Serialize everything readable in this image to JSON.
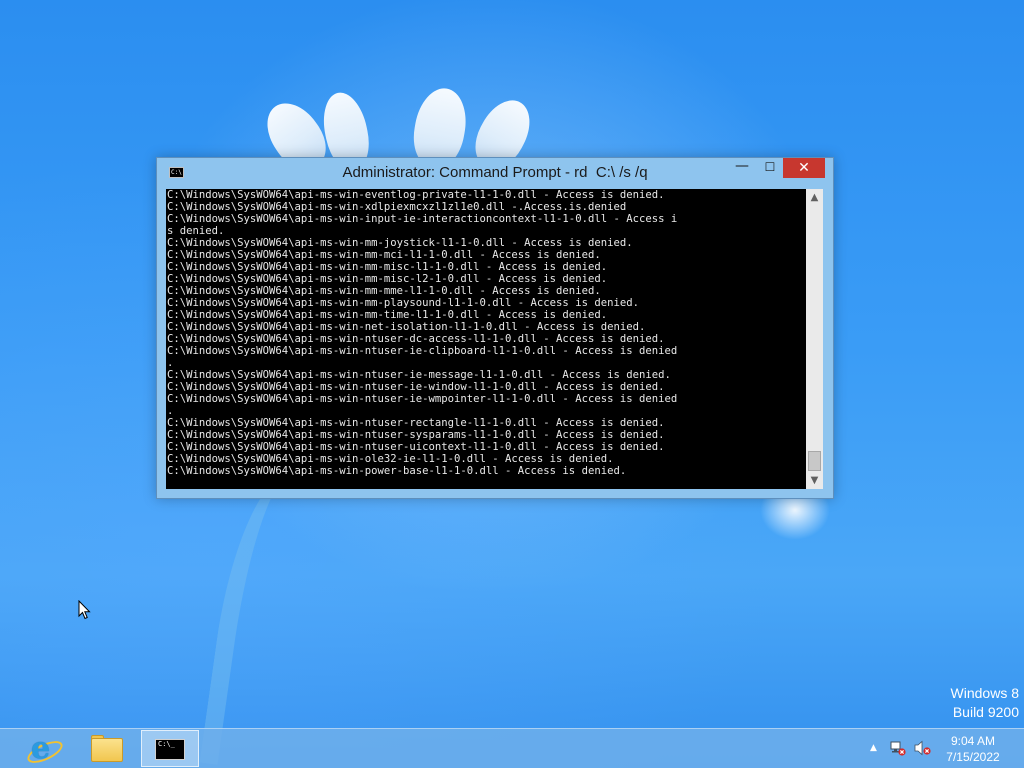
{
  "window": {
    "title": "Administrator: Command Prompt - rd  C:\\ /s /q",
    "icon_glyph": "C:\\",
    "minimize_glyph": "—",
    "maximize_glyph": "☐",
    "close_glyph": "✕"
  },
  "console": {
    "text_color": "#e8e8e8",
    "background": "#000000",
    "lines": [
      "C:\\Windows\\SysWOW64\\api-ms-win-eventlog-private-l1-1-0.dll - Access is denied.",
      "C:\\Windows\\SysWOW64\\api-ms-win-xdlpiexmcxzl1zl1e0.dll -.Access.is.denied",
      "C:\\Windows\\SysWOW64\\api-ms-win-input-ie-interactioncontext-l1-1-0.dll - Access i",
      "s denied.",
      "C:\\Windows\\SysWOW64\\api-ms-win-mm-joystick-l1-1-0.dll - Access is denied.",
      "C:\\Windows\\SysWOW64\\api-ms-win-mm-mci-l1-1-0.dll - Access is denied.",
      "C:\\Windows\\SysWOW64\\api-ms-win-mm-misc-l1-1-0.dll - Access is denied.",
      "C:\\Windows\\SysWOW64\\api-ms-win-mm-misc-l2-1-0.dll - Access is denied.",
      "C:\\Windows\\SysWOW64\\api-ms-win-mm-mme-l1-1-0.dll - Access is denied.",
      "C:\\Windows\\SysWOW64\\api-ms-win-mm-playsound-l1-1-0.dll - Access is denied.",
      "C:\\Windows\\SysWOW64\\api-ms-win-mm-time-l1-1-0.dll - Access is denied.",
      "C:\\Windows\\SysWOW64\\api-ms-win-net-isolation-l1-1-0.dll - Access is denied.",
      "C:\\Windows\\SysWOW64\\api-ms-win-ntuser-dc-access-l1-1-0.dll - Access is denied.",
      "C:\\Windows\\SysWOW64\\api-ms-win-ntuser-ie-clipboard-l1-1-0.dll - Access is denied",
      ".",
      "C:\\Windows\\SysWOW64\\api-ms-win-ntuser-ie-message-l1-1-0.dll - Access is denied.",
      "C:\\Windows\\SysWOW64\\api-ms-win-ntuser-ie-window-l1-1-0.dll - Access is denied.",
      "C:\\Windows\\SysWOW64\\api-ms-win-ntuser-ie-wmpointer-l1-1-0.dll - Access is denied",
      ".",
      "C:\\Windows\\SysWOW64\\api-ms-win-ntuser-rectangle-l1-1-0.dll - Access is denied.",
      "C:\\Windows\\SysWOW64\\api-ms-win-ntuser-sysparams-l1-1-0.dll - Access is denied.",
      "C:\\Windows\\SysWOW64\\api-ms-win-ntuser-uicontext-l1-1-0.dll - Access is denied.",
      "C:\\Windows\\SysWOW64\\api-ms-win-ole32-ie-l1-1-0.dll - Access is denied.",
      "C:\\Windows\\SysWOW64\\api-ms-win-power-base-l1-1-0.dll - Access is denied."
    ]
  },
  "scrollbar": {
    "up_glyph": "▲",
    "down_glyph": "▼"
  },
  "watermark": {
    "line1": "Windows 8",
    "line2": "Build 9200"
  },
  "taskbar": {
    "items": [
      {
        "name": "internet-explorer",
        "icon": "ie-icon",
        "glyph": "e"
      },
      {
        "name": "file-explorer",
        "icon": "folder-icon"
      },
      {
        "name": "command-prompt",
        "icon": "cmd-icon",
        "glyph": "C:\\_",
        "active": true
      }
    ],
    "tray": {
      "chevron": "▲",
      "network_icon": "network-error-icon",
      "volume_icon": "volume-muted-icon",
      "time": "9:04 AM",
      "date": "7/15/2022"
    }
  },
  "colors": {
    "close_button": "#c7372f",
    "window_frame": "#8ec4ee",
    "desktop": "#3a9cf6"
  }
}
